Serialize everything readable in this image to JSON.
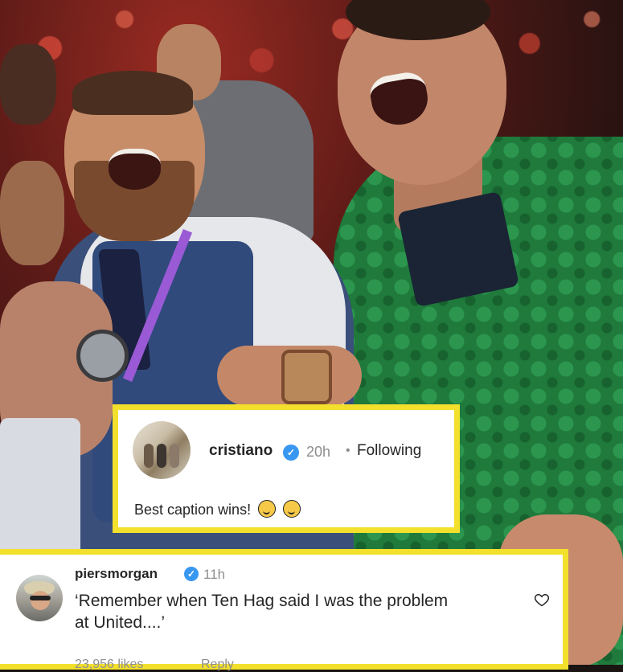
{
  "post_comment": {
    "username": "cristiano",
    "time": "20h",
    "separator": "•",
    "follow_status": "Following",
    "caption": "Best caption wins!",
    "emojis": [
      "thinking-face-icon",
      "grinning-sweat-face-icon"
    ]
  },
  "reply_comment": {
    "username": "piersmorgan",
    "time": "11h",
    "text": "‘Remember when Ten Hag said I was the problem at United....’",
    "likes": "23,956 likes",
    "reply_label": "Reply"
  },
  "colors": {
    "highlight_border": "#f3e02c",
    "verified_blue": "#3897f0",
    "text_primary": "#262626",
    "text_secondary": "#8e8e8e"
  }
}
